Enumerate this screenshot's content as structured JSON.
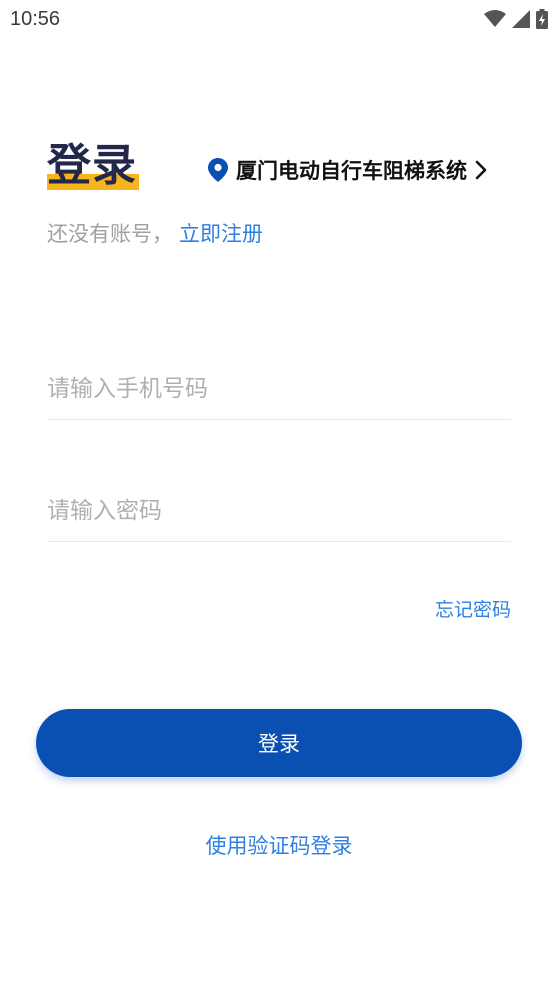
{
  "status_bar": {
    "time": "10:56",
    "icons": [
      "wifi-icon",
      "signal-icon",
      "battery-charging-icon"
    ]
  },
  "login": {
    "title": "登录",
    "title_color": "#23284b",
    "highlight_color": "#f7b51c",
    "region": {
      "icon": "location-pin-icon",
      "label": "厦门电动自行车阻梯系统",
      "chevron": "chevron-right-icon"
    },
    "register_prompt": "还没有账号，",
    "register_link": "立即注册",
    "phone_placeholder": "请输入手机号码",
    "password_placeholder": "请输入密码",
    "forgot_password": "忘记密码",
    "submit_label": "登录",
    "sms_login": "使用验证码登录"
  },
  "colors": {
    "primary": "#0a4fb2",
    "link": "#2f7fe3",
    "placeholder": "#b0b0b0"
  }
}
